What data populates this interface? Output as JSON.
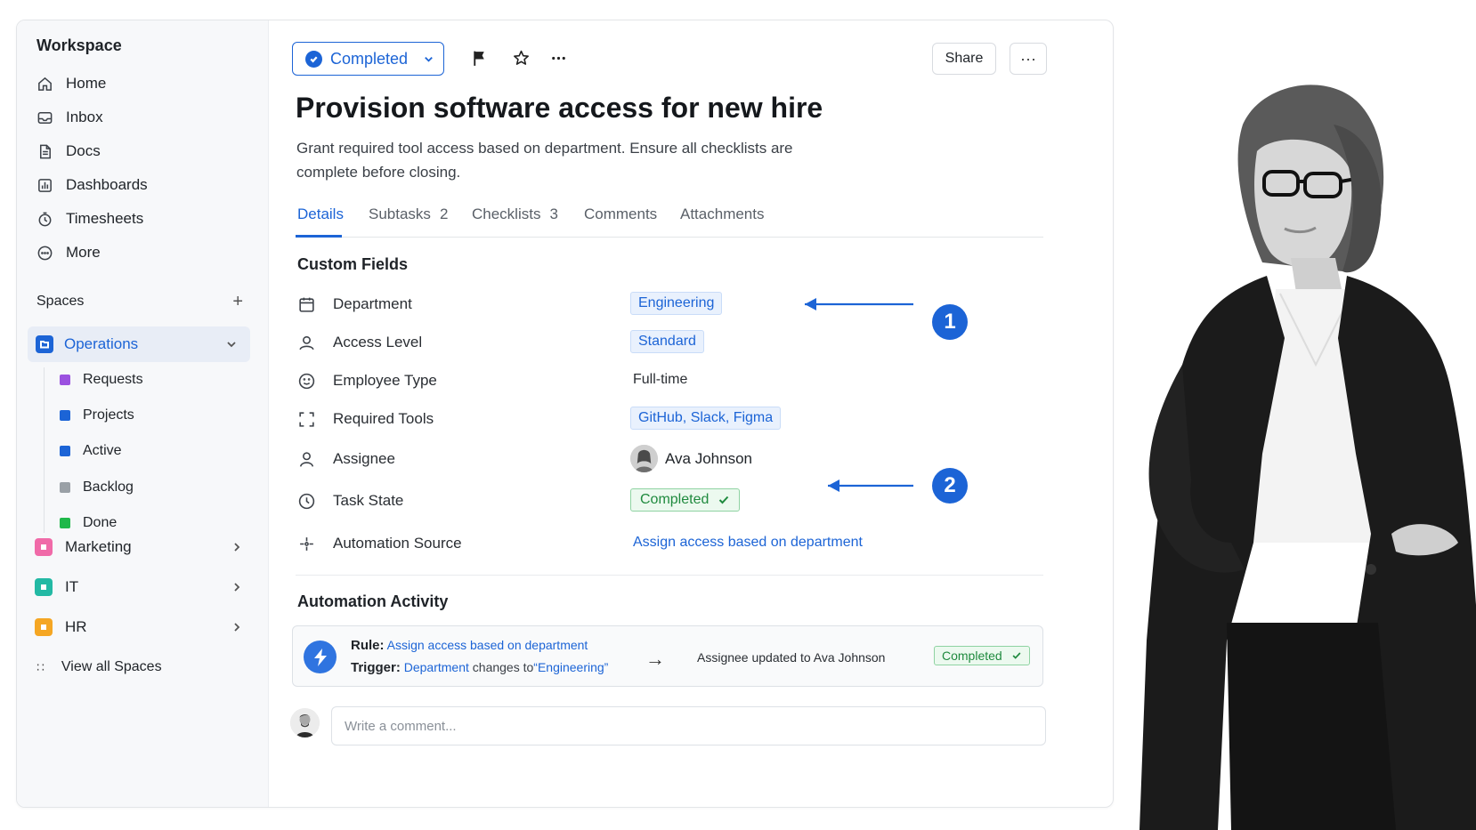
{
  "sidebar": {
    "workspace_title": "Workspace",
    "nav": [
      {
        "label": "Home",
        "icon": "home-icon"
      },
      {
        "label": "Inbox",
        "icon": "inbox-icon"
      },
      {
        "label": "Docs",
        "icon": "doc-icon"
      },
      {
        "label": "Dashboards",
        "icon": "dashboard-icon"
      },
      {
        "label": "Timesheets",
        "icon": "timer-icon"
      },
      {
        "label": "More",
        "icon": "more-circle-icon"
      }
    ],
    "spaces_label": "Spaces",
    "active_space": {
      "label": "Operations",
      "color": "#1c64d6"
    },
    "sub_items": [
      {
        "label": "Requests",
        "color": "#9b51e0"
      },
      {
        "label": "Projects",
        "color": "#1c64d6"
      },
      {
        "label": "Active",
        "color": "#1c64d6"
      },
      {
        "label": "Backlog",
        "color": "#9aa0a6"
      },
      {
        "label": "Done",
        "color": "#1fb84a"
      }
    ],
    "spaces": [
      {
        "label": "Marketing",
        "color": "#f06aa8"
      },
      {
        "label": "IT",
        "color": "#23b9a4"
      },
      {
        "label": "HR",
        "color": "#f5a623"
      }
    ],
    "view_all": "View all Spaces"
  },
  "toolbar": {
    "status": "Completed",
    "share": "Share",
    "more": "···"
  },
  "task": {
    "title": "Provision software access for new hire",
    "description": "Grant required tool access based on department. Ensure all checklists are complete before closing."
  },
  "tabs": [
    {
      "label": "Details",
      "count": ""
    },
    {
      "label": "Subtasks",
      "count": "2"
    },
    {
      "label": "Checklists",
      "count": "3"
    },
    {
      "label": "Comments",
      "count": ""
    },
    {
      "label": "Attachments",
      "count": ""
    }
  ],
  "custom_fields": {
    "title": "Custom Fields",
    "rows": [
      {
        "label": "Department",
        "value": "Engineering",
        "icon": "calendar-icon"
      },
      {
        "label": "Access Level",
        "value": "Standard",
        "icon": "user-badge-icon"
      },
      {
        "label": "Employee Type",
        "value": "Full-time",
        "icon": "smile-icon"
      },
      {
        "label": "Required Tools",
        "value": "GitHub, Slack, Figma",
        "icon": "frame-icon"
      },
      {
        "label": "Assignee",
        "value": "Ava Johnson",
        "icon": "person-icon"
      },
      {
        "label": "Task State",
        "value": "Completed",
        "icon": "clock-icon"
      },
      {
        "label": "Automation Source",
        "value": "Assign access based on department",
        "icon": "automation-icon"
      }
    ]
  },
  "automation": {
    "title": "Automation Activity",
    "rule_label": "Rule:",
    "rule_value": "Assign access based on department",
    "trigger_label": "Trigger:",
    "trigger_field": "Department",
    "trigger_text": "changes to",
    "trigger_value": "“Engineering”",
    "result": "Assignee updated to Ava Johnson",
    "result_status": "Completed"
  },
  "comment": {
    "placeholder": "Write a comment..."
  },
  "annotations": [
    "1",
    "2"
  ],
  "colors": {
    "accent": "#1c64d6",
    "success": "#1f8a3e"
  }
}
